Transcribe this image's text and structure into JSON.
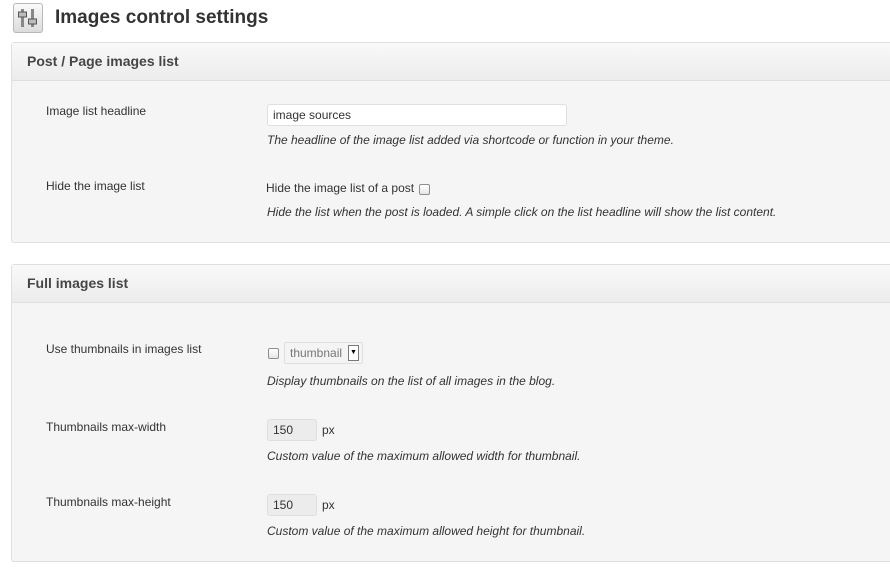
{
  "header": {
    "title": "Images control settings",
    "icon": "settings-sliders-icon"
  },
  "post_page_section": {
    "title": "Post / Page images list",
    "headline": {
      "label": "Image list headline",
      "value": "image sources",
      "description": "The headline of the image list added via shortcode or function in your theme."
    },
    "hide_list": {
      "label": "Hide the image list",
      "checkbox_label": "Hide the image list of a post",
      "checked": false,
      "description": "Hide the list when the post is loaded. A simple click on the list headline will show the list content."
    }
  },
  "full_list_section": {
    "title": "Full images list",
    "thumbnails": {
      "label": "Use thumbnails in images list",
      "checked": false,
      "select_value": "thumbnail",
      "description": "Display thumbnails on the list of all images in the blog."
    },
    "max_width": {
      "label": "Thumbnails max-width",
      "value": "150",
      "unit": "px",
      "description": "Custom value of the maximum allowed width for thumbnail."
    },
    "max_height": {
      "label": "Thumbnails max-height",
      "value": "150",
      "unit": "px",
      "description": "Custom value of the maximum allowed height for thumbnail."
    }
  }
}
